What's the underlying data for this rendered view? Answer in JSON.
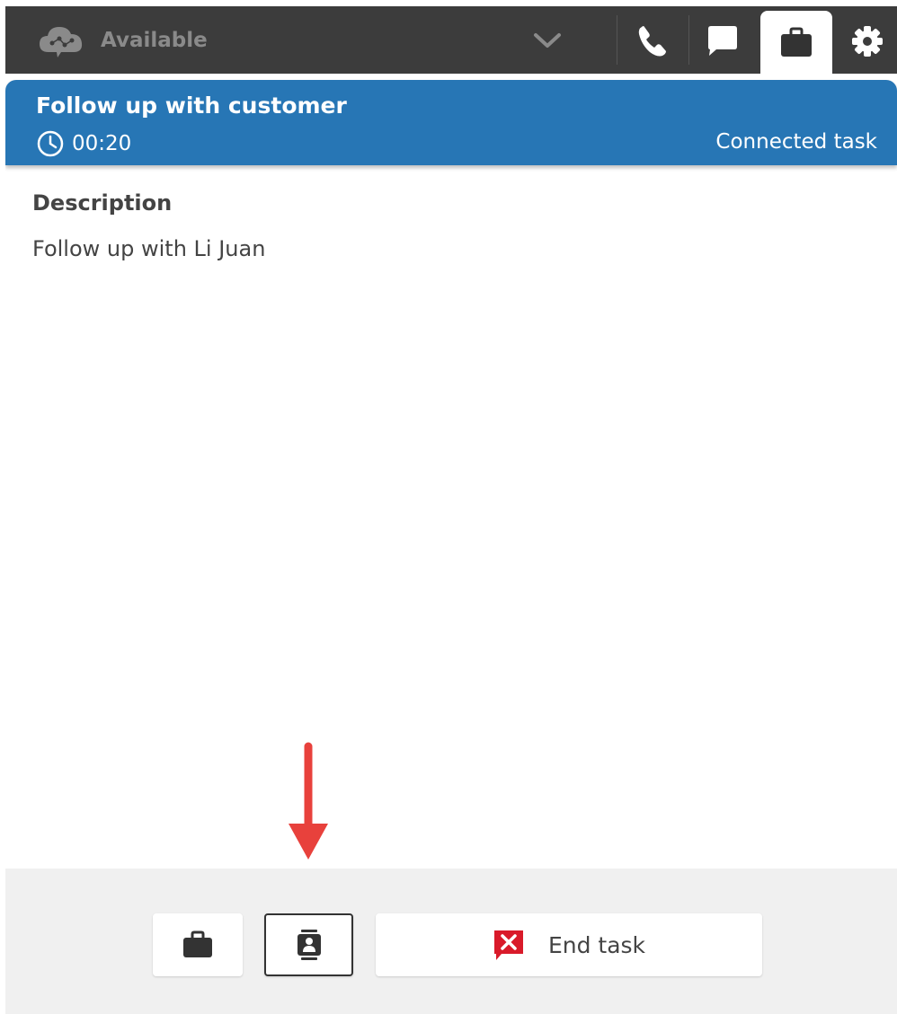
{
  "topbar": {
    "status_label": "Available",
    "icons": [
      "cloud-status-icon",
      "chevron-down-icon",
      "phone-icon",
      "chat-icon",
      "briefcase-icon",
      "gear-icon"
    ],
    "active_tab": "tasks"
  },
  "task": {
    "title": "Follow up with customer",
    "timer": "00:20",
    "state": "Connected task"
  },
  "details": {
    "heading": "Description",
    "text": "Follow up with Li Juan"
  },
  "footer": {
    "end_label": "End task"
  },
  "colors": {
    "topbar_bg": "#3c3c3c",
    "header_blue": "#2776b5",
    "end_red": "#d91a2a",
    "annotation_red": "#e8413c"
  }
}
